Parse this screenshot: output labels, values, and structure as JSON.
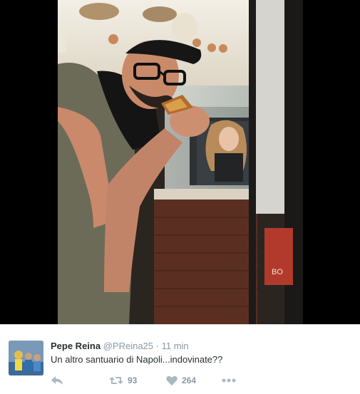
{
  "tweet": {
    "author_name": "Pepe Reina",
    "author_handle": "@PReina25",
    "separator": "·",
    "time": "11 min",
    "text": "Un altro santuario di Napoli...indovinate??",
    "retweets": "93",
    "likes": "264"
  },
  "photo_sign": {
    "text": "BO"
  },
  "icons": {
    "reply": "reply-icon",
    "retweet": "retweet-icon",
    "like": "heart-icon",
    "more": "more-icon"
  },
  "colors": {
    "name": "#292f33",
    "meta": "#8899a6",
    "border": "#e6ecf0"
  }
}
